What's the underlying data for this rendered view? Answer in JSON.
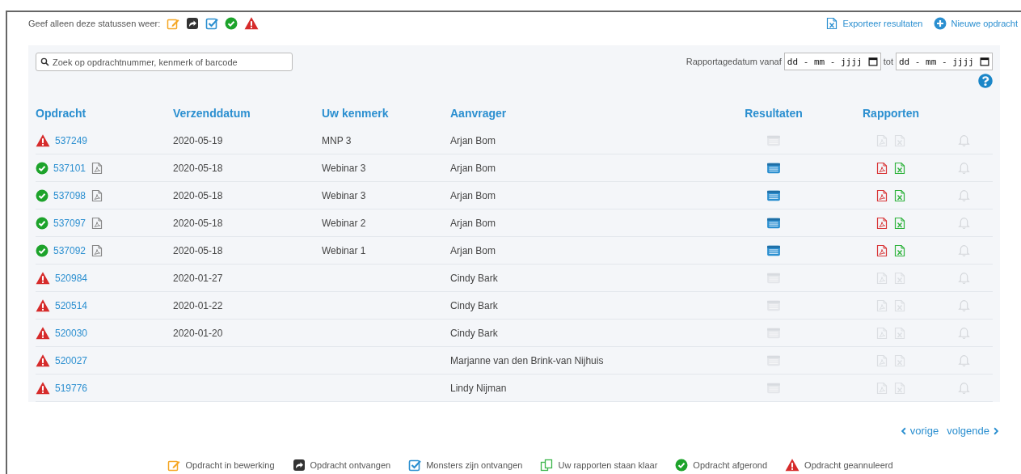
{
  "status_filter": {
    "label": "Geef alleen deze statussen weer:",
    "statuses": [
      {
        "kind": "editing"
      },
      {
        "kind": "received"
      },
      {
        "kind": "samples"
      },
      {
        "kind": "done"
      },
      {
        "kind": "cancelled"
      }
    ]
  },
  "actions": [
    {
      "kind": "export",
      "label": "Exporteer resultaten"
    },
    {
      "kind": "new",
      "label": "Nieuwe opdracht"
    }
  ],
  "search": {
    "placeholder": "Zoek op opdrachtnummer, kenmerk of barcode"
  },
  "date_filter": {
    "label_from": "Rapportagedatum vanaf",
    "from_placeholder": "dd - mm - jjjj",
    "label_to": "tot",
    "to_placeholder": "dd - mm - jjjj"
  },
  "table": {
    "columns": [
      "Opdracht",
      "Verzenddatum",
      "Uw kenmerk",
      "Aanvrager",
      "Resultaten",
      "Rapporten"
    ],
    "rows": [
      {
        "kind": "cancelled",
        "number": "537249",
        "pdf": false,
        "date": "2020-05-19",
        "reference": "MNP 3",
        "requester": "Arjan Bom",
        "available": false
      },
      {
        "kind": "done",
        "number": "537101",
        "pdf": true,
        "date": "2020-05-18",
        "reference": "Webinar 3",
        "requester": "Arjan Bom",
        "available": true
      },
      {
        "kind": "done",
        "number": "537098",
        "pdf": true,
        "date": "2020-05-18",
        "reference": "Webinar 3",
        "requester": "Arjan Bom",
        "available": true
      },
      {
        "kind": "done",
        "number": "537097",
        "pdf": true,
        "date": "2020-05-18",
        "reference": "Webinar 2",
        "requester": "Arjan Bom",
        "available": true
      },
      {
        "kind": "done",
        "number": "537092",
        "pdf": true,
        "date": "2020-05-18",
        "reference": "Webinar 1",
        "requester": "Arjan Bom",
        "available": true
      },
      {
        "kind": "cancelled",
        "number": "520984",
        "pdf": false,
        "date": "2020-01-27",
        "reference": "",
        "requester": "Cindy Bark",
        "available": false
      },
      {
        "kind": "cancelled",
        "number": "520514",
        "pdf": false,
        "date": "2020-01-22",
        "reference": "",
        "requester": "Cindy Bark",
        "available": false
      },
      {
        "kind": "cancelled",
        "number": "520030",
        "pdf": false,
        "date": "2020-01-20",
        "reference": "",
        "requester": "Cindy Bark",
        "available": false
      },
      {
        "kind": "cancelled",
        "number": "520027",
        "pdf": false,
        "date": "",
        "reference": "",
        "requester": "Marjanne van den Brink-van Nijhuis",
        "available": false
      },
      {
        "kind": "cancelled",
        "number": "519776",
        "pdf": false,
        "date": "",
        "reference": "",
        "requester": "Lindy Nijman",
        "available": false
      }
    ]
  },
  "pagination": {
    "previous": "vorige",
    "next": "volgende"
  },
  "legend": [
    {
      "kind": "editing",
      "label": "Opdracht in bewerking"
    },
    {
      "kind": "received",
      "label": "Opdracht ontvangen"
    },
    {
      "kind": "samples",
      "label": "Monsters zijn ontvangen"
    },
    {
      "kind": "reports",
      "label": "Uw rapporten staan klaar"
    },
    {
      "kind": "done",
      "label": "Opdracht afgerond"
    },
    {
      "kind": "cancelled",
      "label": "Opdracht geannuleerd"
    }
  ]
}
